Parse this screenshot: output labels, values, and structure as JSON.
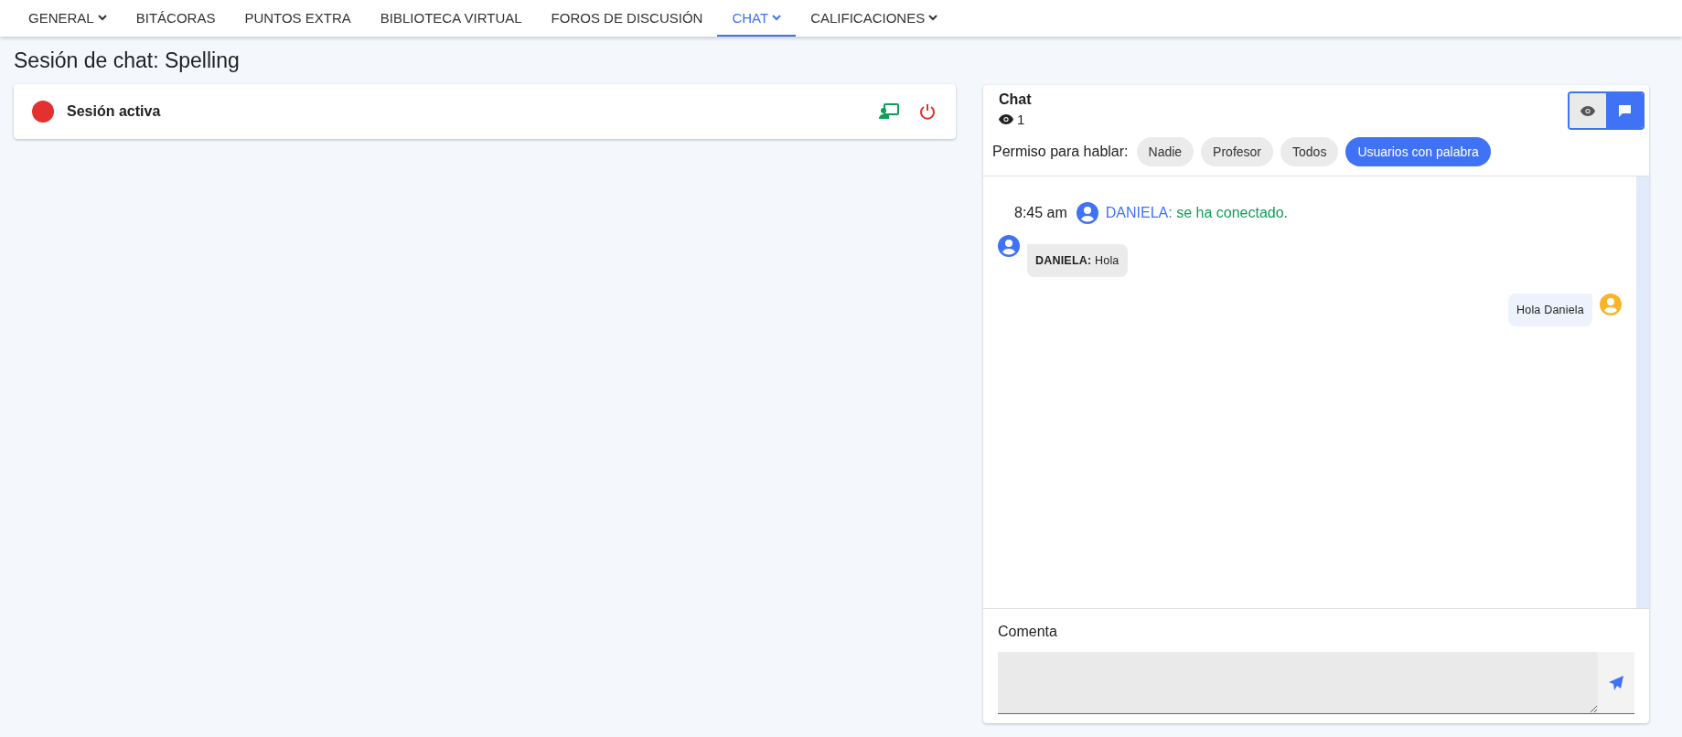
{
  "nav": [
    {
      "label": "GENERAL",
      "dropdown": true,
      "selected": false
    },
    {
      "label": "BITÁCORAS",
      "dropdown": false,
      "selected": false
    },
    {
      "label": "PUNTOS EXTRA",
      "dropdown": false,
      "selected": false
    },
    {
      "label": "BIBLIOTECA VIRTUAL",
      "dropdown": false,
      "selected": false
    },
    {
      "label": "FOROS DE DISCUSIÓN",
      "dropdown": false,
      "selected": false
    },
    {
      "label": "CHAT",
      "dropdown": true,
      "selected": true
    },
    {
      "label": "CALIFICACIONES",
      "dropdown": true,
      "selected": false
    }
  ],
  "page_title": "Sesión de chat: Spelling",
  "session": {
    "status": "Sesión activa",
    "active": true
  },
  "chat": {
    "title": "Chat",
    "viewers": "1",
    "view_toggle": [
      {
        "kind": "eye",
        "selected": false
      },
      {
        "kind": "messages",
        "selected": true
      }
    ],
    "permission_label": "Permiso para hablar:",
    "permissions": [
      {
        "label": "Nadie",
        "selected": false
      },
      {
        "label": "Profesor",
        "selected": false
      },
      {
        "label": "Todos",
        "selected": false
      },
      {
        "label": "Usuarios con palabra",
        "selected": true
      }
    ],
    "messages": [
      {
        "kind": "system",
        "time": "8:45 am",
        "user": "DANIELA:",
        "text": "se ha conectado."
      },
      {
        "kind": "incoming",
        "user": "DANIELA:",
        "text": "Hola"
      },
      {
        "kind": "outgoing",
        "text": "Hola Daniela"
      }
    ],
    "comment_label": "Comenta"
  }
}
